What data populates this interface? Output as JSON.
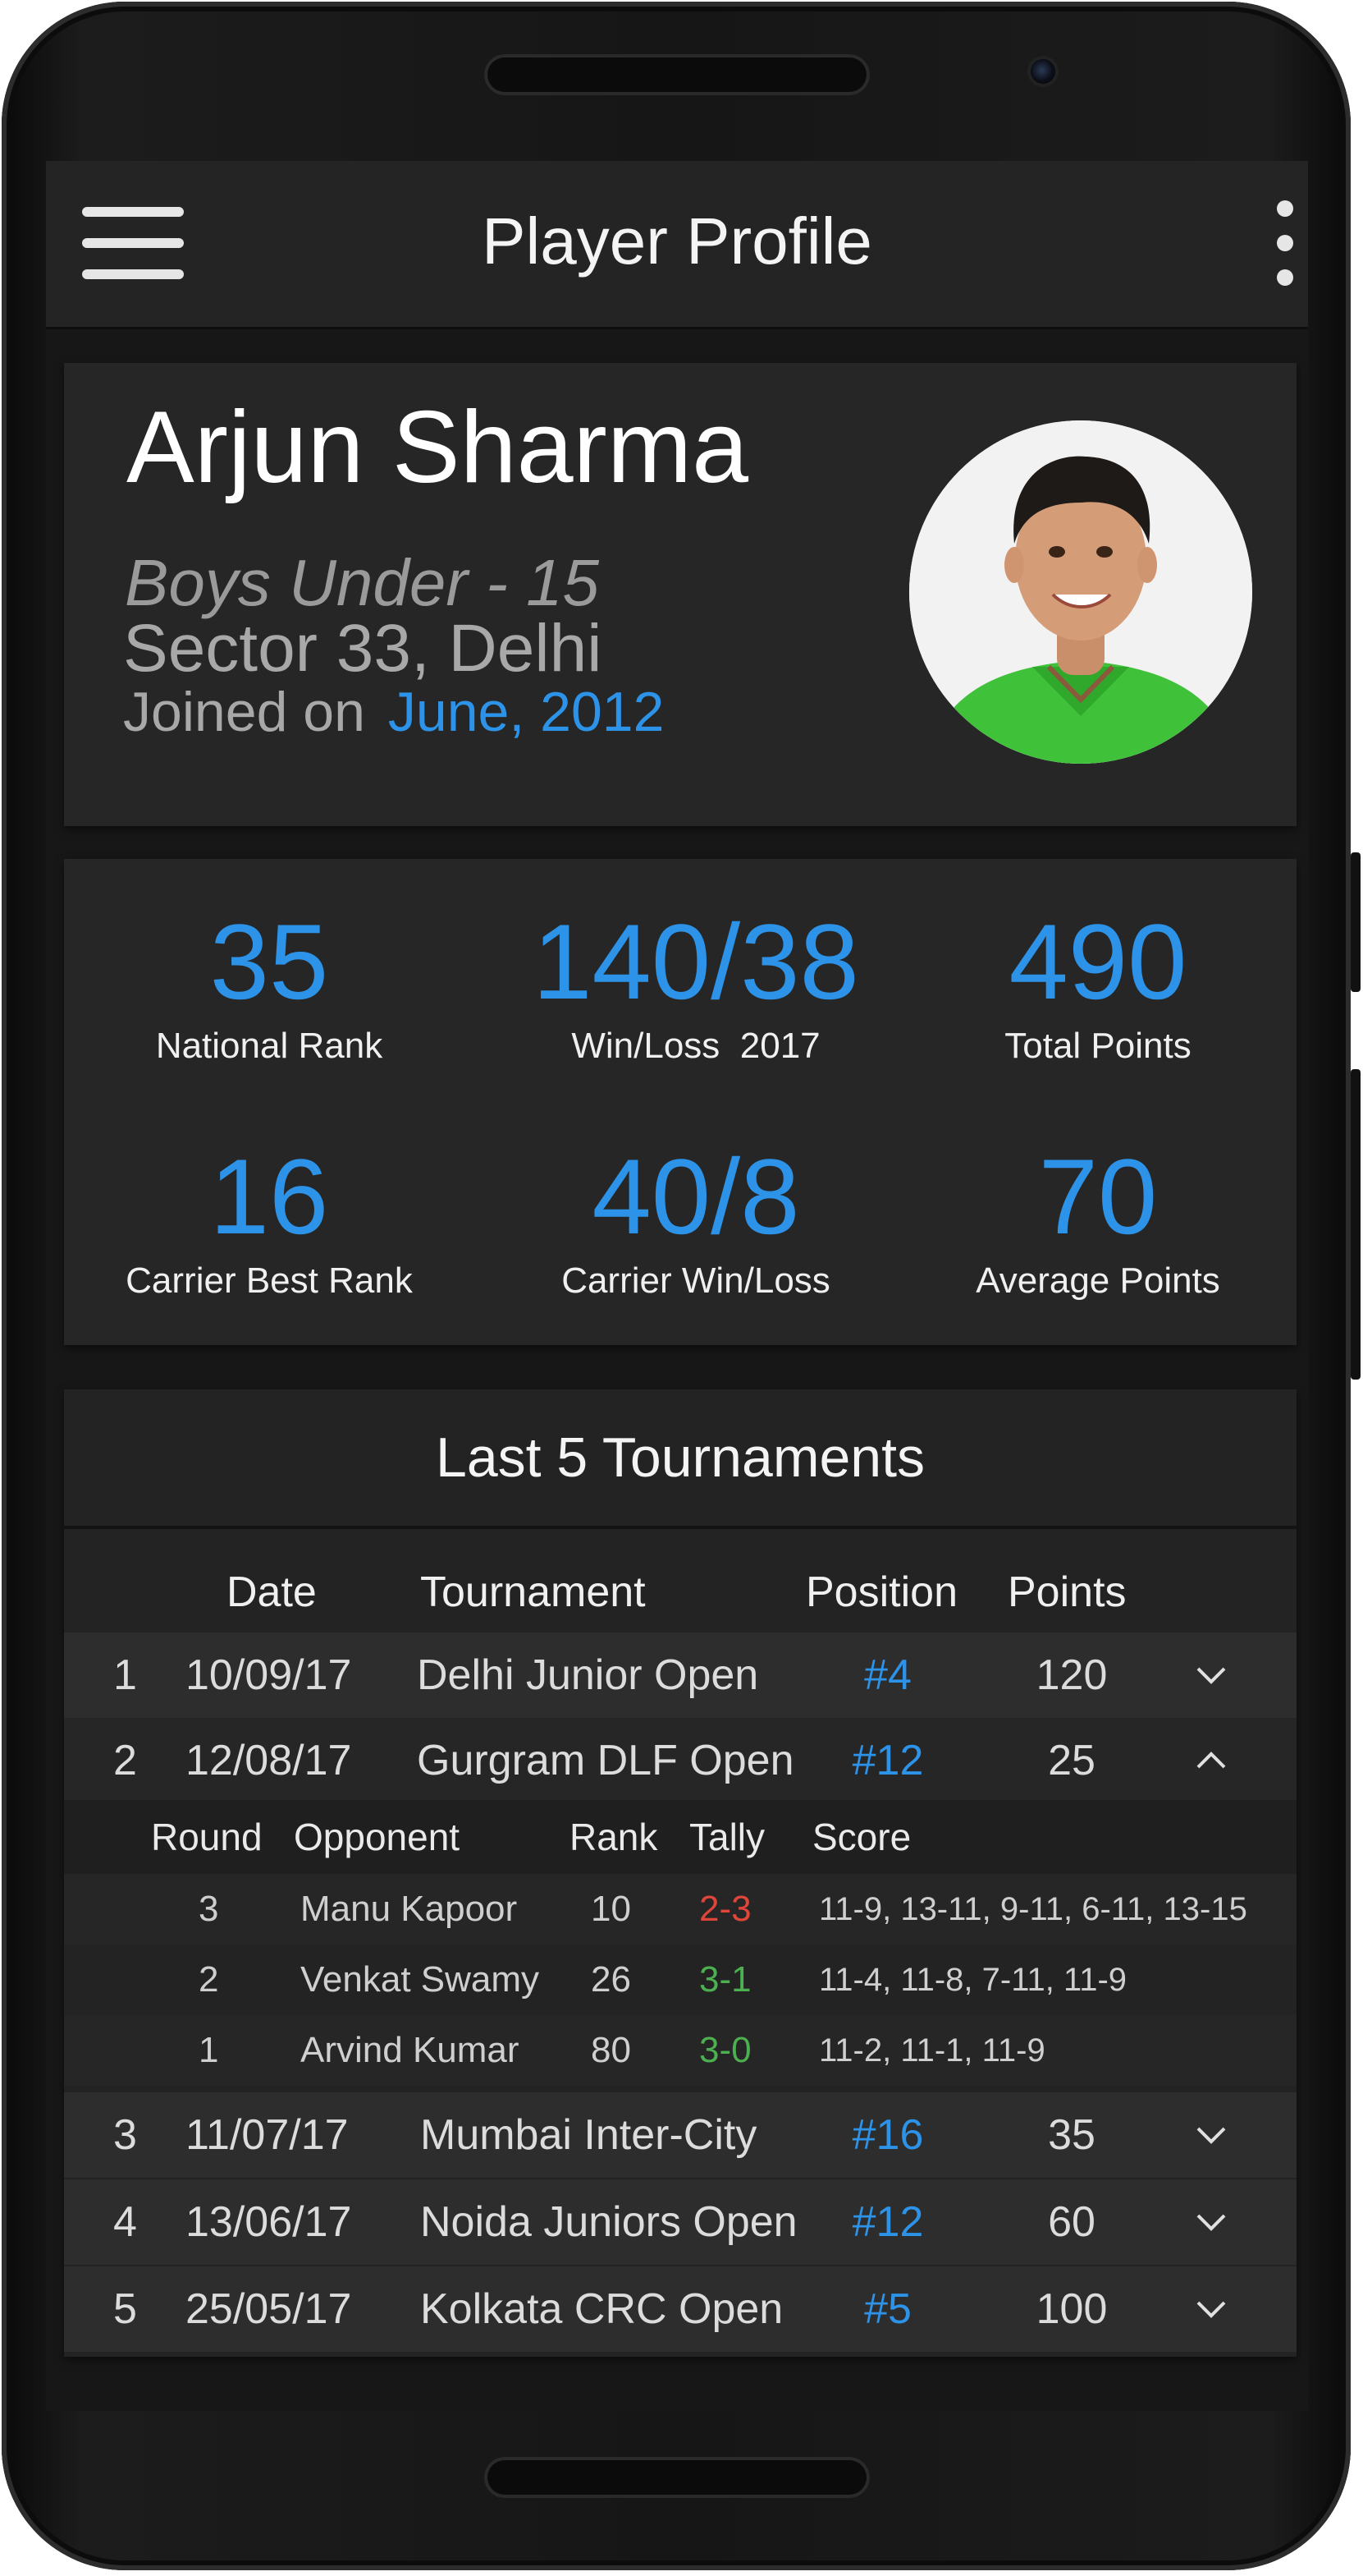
{
  "app_bar": {
    "title": "Player Profile",
    "menu_icon": "hamburger-menu-icon",
    "overflow_icon": "more-vert-icon"
  },
  "profile": {
    "name": "Arjun Sharma",
    "category": "Boys Under - 15",
    "location": "Sector 33, Delhi",
    "joined_label": "Joined on",
    "joined_date": "June, 2012"
  },
  "stats": [
    {
      "value": "35",
      "label": "National Rank"
    },
    {
      "value": "140/38",
      "label": "Win/Loss  2017"
    },
    {
      "value": "490",
      "label": "Total Points"
    },
    {
      "value": "16",
      "label": "Carrier Best Rank"
    },
    {
      "value": "40/8",
      "label": "Carrier Win/Loss"
    },
    {
      "value": "70",
      "label": "Average Points"
    }
  ],
  "tournaments": {
    "title": "Last 5 Tournaments",
    "headers": {
      "date": "Date",
      "tournament": "Tournament",
      "position": "Position",
      "points": "Points"
    },
    "rows": [
      {
        "index": "1",
        "date": "10/09/17",
        "name": "Delhi Junior Open",
        "position": "#4",
        "points": "120",
        "expanded": false
      },
      {
        "index": "2",
        "date": "12/08/17",
        "name": "Gurgram DLF Open",
        "position": "#12",
        "points": "25",
        "expanded": true
      },
      {
        "index": "3",
        "date": "11/07/17",
        "name": "Mumbai Inter-City",
        "position": "#16",
        "points": "35",
        "expanded": false
      },
      {
        "index": "4",
        "date": "13/06/17",
        "name": "Noida Juniors Open",
        "position": "#12",
        "points": "60",
        "expanded": false
      },
      {
        "index": "5",
        "date": "25/05/17",
        "name": "Kolkata CRC Open",
        "position": "#5",
        "points": "100",
        "expanded": false
      }
    ],
    "matches": {
      "headers": {
        "round": "Round",
        "opponent": "Opponent",
        "rank": "Rank",
        "tally": "Tally",
        "score": "Score"
      },
      "rows": [
        {
          "round": "3",
          "opponent": "Manu Kapoor",
          "rank": "10",
          "tally": "2-3",
          "result": "loss",
          "score": "11-9, 13-11, 9-11, 6-11, 13-15"
        },
        {
          "round": "2",
          "opponent": "Venkat Swamy",
          "rank": "26",
          "tally": "3-1",
          "result": "win",
          "score": "11-4, 11-8, 7-11, 11-9"
        },
        {
          "round": "1",
          "opponent": "Arvind Kumar",
          "rank": "80",
          "tally": "3-0",
          "result": "win",
          "score": "11-2, 11-1, 11-9"
        }
      ]
    }
  },
  "colors": {
    "accent": "#2d93e8",
    "win": "#4caf50",
    "loss": "#e0453a",
    "background": "#171717",
    "card": "#262626"
  }
}
